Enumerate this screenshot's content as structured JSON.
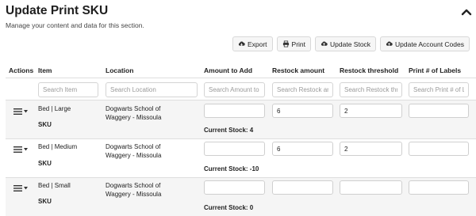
{
  "header": {
    "title": "Update Print SKU",
    "subtitle": "Manage your content and data for this section.",
    "collapse_icon": "chevron-up-icon"
  },
  "toolbar": {
    "export_label": "Export",
    "print_label": "Print",
    "update_stock_label": "Update Stock",
    "update_codes_label": "Update Account Codes"
  },
  "table": {
    "columns": [
      "Actions",
      "Item",
      "Location",
      "Amount to Add",
      "Restock amount",
      "Restock threshold",
      "Print # of Labels"
    ],
    "filters": {
      "item": "Search Item",
      "location": "Search Location",
      "amount": "Search Amount to Add",
      "restock_amount": "Search Restock amount",
      "restock_threshold": "Search Restock threshold",
      "labels": "Search Print # of Labels"
    },
    "rows": [
      {
        "item": "Bed | Large",
        "sku_label": "SKU",
        "location_line1": "Dogwarts School of",
        "location_line2": "Waggery - Missoula",
        "amount_to_add": "",
        "current_stock": "Current Stock: 4",
        "restock_amount": "6",
        "restock_threshold": "2",
        "labels": ""
      },
      {
        "item": "Bed | Medium",
        "sku_label": "SKU",
        "location_line1": "Dogwarts School of",
        "location_line2": "Waggery - Missoula",
        "amount_to_add": "",
        "current_stock": "Current Stock: -10",
        "restock_amount": "6",
        "restock_threshold": "2",
        "labels": ""
      },
      {
        "item": "Bed | Small",
        "sku_label": "SKU",
        "location_line1": "Dogwarts School of",
        "location_line2": "Waggery - Missoula",
        "amount_to_add": "",
        "current_stock": "Current Stock: 0",
        "restock_amount": "",
        "restock_threshold": "",
        "labels": ""
      }
    ]
  }
}
